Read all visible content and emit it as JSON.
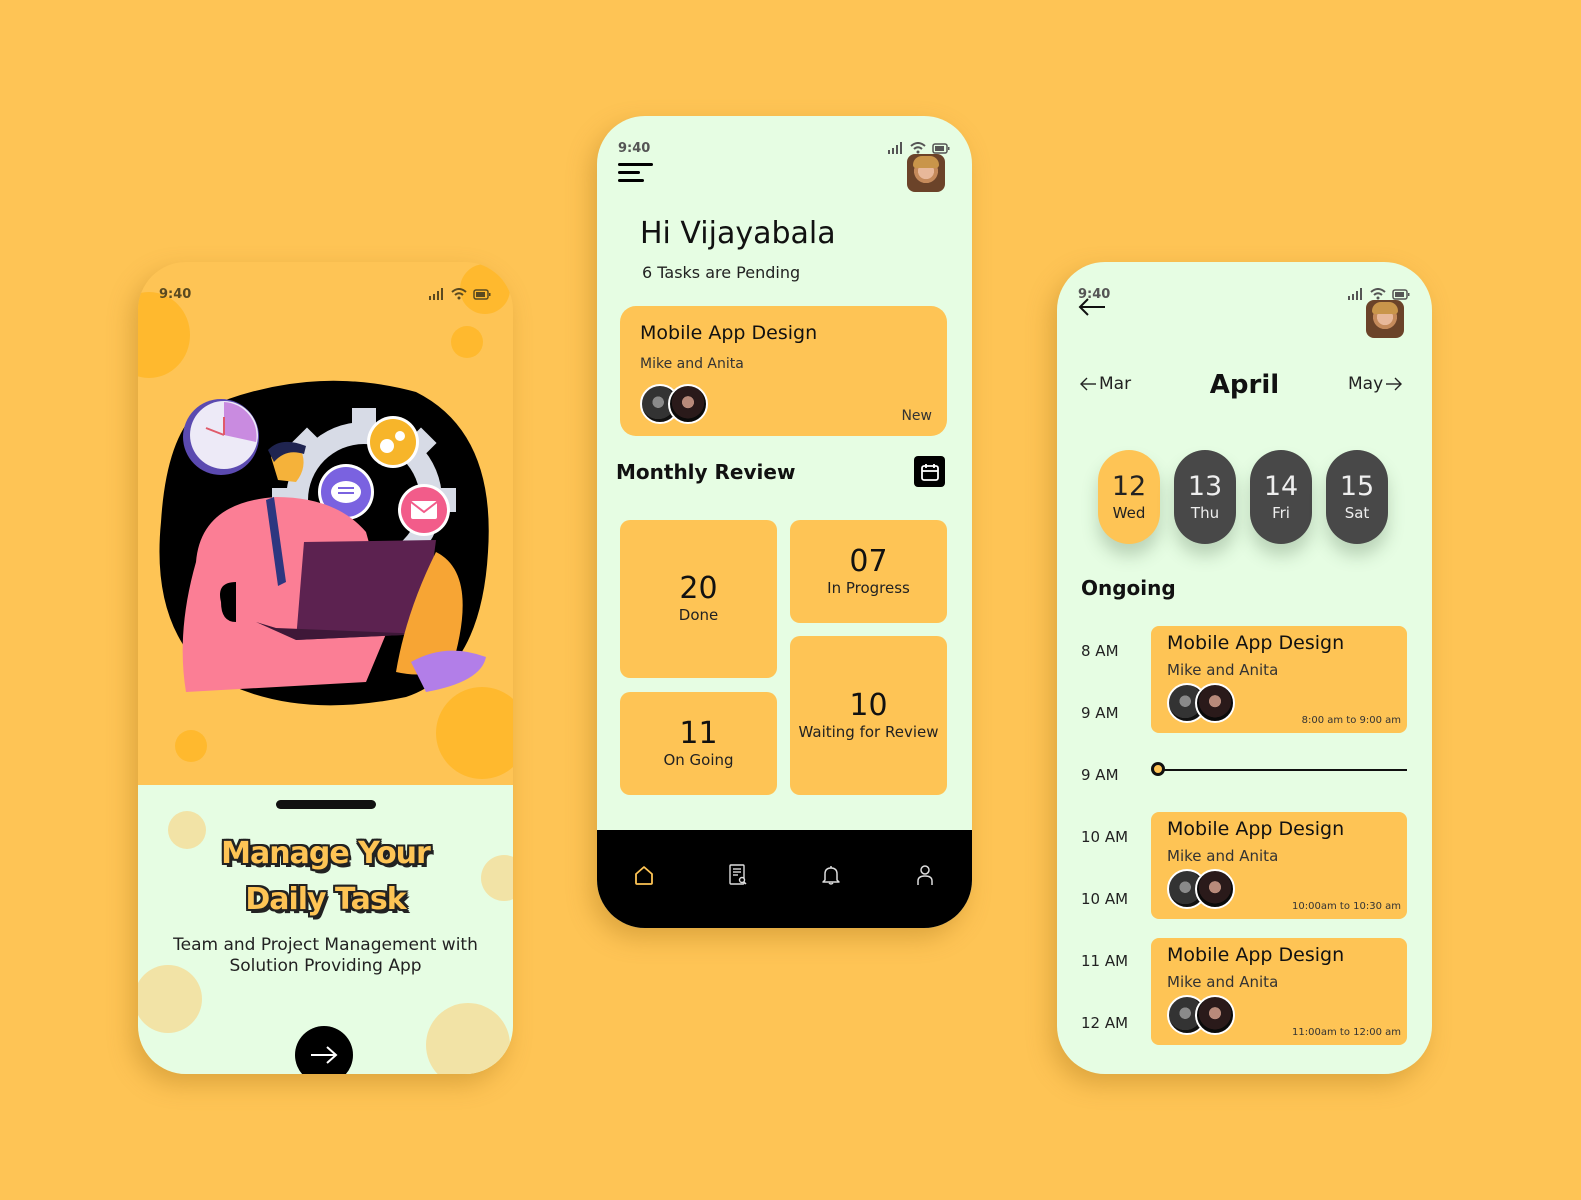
{
  "theme": {
    "accent": "#FEC455",
    "surface": "#E6FDE3",
    "dark": "#000000",
    "chip_dark": "#484848"
  },
  "status_bar": {
    "time": "9:40",
    "icons": [
      "signal-icon",
      "wifi-icon",
      "battery-icon"
    ]
  },
  "onboarding": {
    "headline_line1": "Manage Your",
    "headline_line2": "Daily Task",
    "subtitle_line1": "Team and Project Management with",
    "subtitle_line2": "Solution Providing App",
    "next_button_icon": "arrow-right-icon",
    "illustration": "man-with-laptop-gear-clock-chat-mail"
  },
  "home": {
    "greeting": "Hi Vijayabala",
    "pending": "6 Tasks are Pending",
    "featured_task": {
      "title": "Mobile App Design",
      "members": "Mike and Anita",
      "status": "New"
    },
    "monthly_review": {
      "title": "Monthly Review",
      "stats": [
        {
          "value": "20",
          "label": "Done"
        },
        {
          "value": "07",
          "label": "In Progress"
        },
        {
          "value": "11",
          "label": "On Going"
        },
        {
          "value": "10",
          "label": "Waiting for Review"
        }
      ]
    },
    "nav": [
      {
        "name": "home",
        "icon": "home-icon",
        "active": true
      },
      {
        "name": "tasks",
        "icon": "document-search-icon",
        "active": false
      },
      {
        "name": "notifications",
        "icon": "bell-icon",
        "active": false
      },
      {
        "name": "profile",
        "icon": "user-icon",
        "active": false
      }
    ]
  },
  "calendar": {
    "prev_month": "Mar",
    "month": "April",
    "next_month": "May",
    "days": [
      {
        "day": "12",
        "weekday": "Wed",
        "selected": true
      },
      {
        "day": "13",
        "weekday": "Thu",
        "selected": false
      },
      {
        "day": "14",
        "weekday": "Fri",
        "selected": false
      },
      {
        "day": "15",
        "weekday": "Sat",
        "selected": false
      }
    ],
    "section": "Ongoing",
    "time_labels": [
      "8 AM",
      "9 AM",
      "9 AM",
      "10 AM",
      "10 AM",
      "11 AM",
      "12 AM"
    ],
    "events": [
      {
        "title": "Mobile App Design",
        "members": "Mike and Anita",
        "range": "8:00 am to 9:00 am"
      },
      {
        "title": "Mobile App Design",
        "members": "Mike and Anita",
        "range": "10:00am to 10:30 am"
      },
      {
        "title": "Mobile App Design",
        "members": "Mike and Anita",
        "range": "11:00am to 12:00 am"
      }
    ]
  }
}
